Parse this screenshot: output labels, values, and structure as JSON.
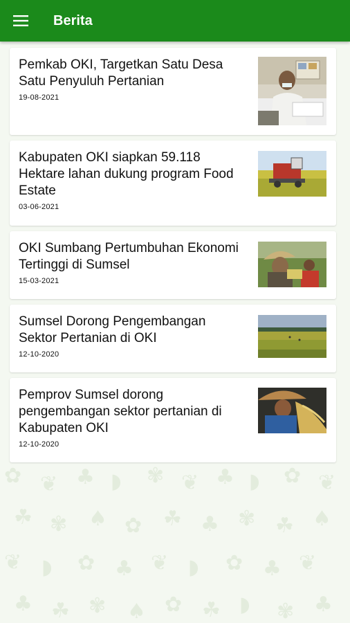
{
  "header": {
    "title": "Berita",
    "menu_icon": "hamburger-menu-icon",
    "bg_color": "#1b8a1b"
  },
  "news": [
    {
      "title": "Pemkab OKI, Targetkan Satu Desa Satu Penyuluh Pertanian",
      "date": "19-08-2021",
      "thumbnail": "official-at-desk"
    },
    {
      "title": "Kabupaten OKI siapkan 59.118 Hektare lahan dukung program Food Estate",
      "date": "03-06-2021",
      "thumbnail": "harvester-in-field"
    },
    {
      "title": "OKI Sumbang Pertumbuhan Ekonomi Tertinggi di Sumsel",
      "date": "15-03-2021",
      "thumbnail": "farmers-harvesting"
    },
    {
      "title": "Sumsel Dorong Pengembangan Sektor Pertanian di OKI",
      "date": "12-10-2020",
      "thumbnail": "rice-field-landscape"
    },
    {
      "title": "Pemprov Sumsel dorong pengembangan sektor pertanian di Kabupaten OKI",
      "date": "12-10-2020",
      "thumbnail": "farmer-with-rice"
    }
  ]
}
